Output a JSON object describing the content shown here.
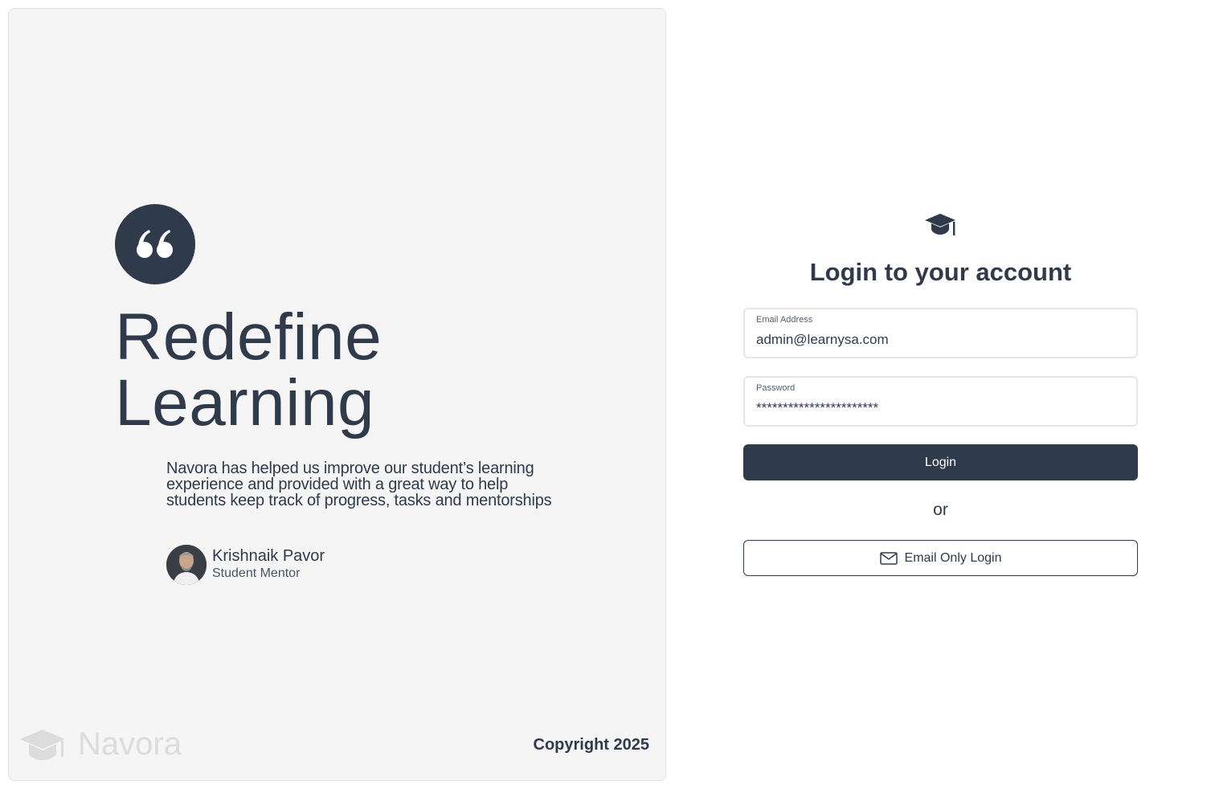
{
  "left_panel": {
    "headline_line1": "Redefine",
    "headline_line2": "Learning",
    "testimonial": "Navora has helped us improve our student’s learning experience and provided with a great way to help students keep track of progress, tasks and mentorships",
    "author_name": "Krishnaik Pavor",
    "author_role": "Student Mentor",
    "brand_name": "Navora",
    "copyright": "Copyright 2025"
  },
  "login": {
    "title": "Login to your account",
    "email_label": "Email Address",
    "email_value": "admin@learnysa.com",
    "password_label": "Password",
    "password_value": "***********************",
    "login_button": "Login",
    "or_text": "or",
    "email_only_button": "Email Only Login"
  },
  "colors": {
    "primary": "#2f3a4b",
    "panel_bg": "#f5f5f5",
    "brand_watermark": "#dcdcdc"
  },
  "icons": {
    "quote": "quote-icon",
    "cap": "graduation-cap-icon",
    "mail": "mail-icon"
  }
}
